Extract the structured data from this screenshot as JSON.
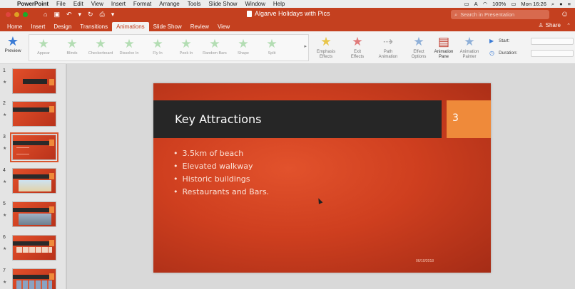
{
  "menubar": {
    "app_name": "PowerPoint",
    "items": [
      "File",
      "Edit",
      "View",
      "Insert",
      "Format",
      "Arrange",
      "Tools",
      "Slide Show",
      "Window",
      "Help"
    ],
    "battery": "100%",
    "clock": "Mon 16:26"
  },
  "titlebar": {
    "title": "Algarve Holidays with Pics",
    "search_placeholder": "Search in Presentation",
    "colors": {
      "accent": "#c4401f",
      "search_bg": "#d86a4e"
    }
  },
  "tabs": {
    "items": [
      "Home",
      "Insert",
      "Design",
      "Transitions",
      "Animations",
      "Slide Show",
      "Review",
      "View"
    ],
    "active": "Animations",
    "share_label": "Share"
  },
  "ribbon": {
    "preview_label": "Preview",
    "gallery": [
      "Appear",
      "Blinds",
      "Checkerboard",
      "Dissolve In",
      "Fly In",
      "Peek In",
      "Random Bars",
      "Shape",
      "Split"
    ],
    "buttons": [
      {
        "label1": "Emphasis",
        "label2": "Effects"
      },
      {
        "label1": "Exit",
        "label2": "Effects"
      },
      {
        "label1": "Path",
        "label2": "Animation"
      },
      {
        "label1": "Effect",
        "label2": "Options"
      },
      {
        "label1": "Animation",
        "label2": "Pane"
      },
      {
        "label1": "Animation",
        "label2": "Painter"
      }
    ],
    "start_label": "Start:",
    "duration_label": "Duration:"
  },
  "thumbnails": [
    {
      "num": "1",
      "title": "Welcome to Portugal"
    },
    {
      "num": "2",
      "title": ""
    },
    {
      "num": "3",
      "title": ""
    },
    {
      "num": "4",
      "title": ""
    },
    {
      "num": "5",
      "title": ""
    },
    {
      "num": "6",
      "title": ""
    },
    {
      "num": "7",
      "title": ""
    }
  ],
  "selected_slide": "3",
  "slide": {
    "title": "Key Attractions",
    "number": "3",
    "bullets": [
      "3.5km of beach",
      "Elevated walkway",
      "Historic buildings",
      "Restaurants and Bars."
    ],
    "date": "06/10/2018",
    "colors": {
      "background": "#cf3f1f",
      "title_bar": "#262626",
      "number_box": "#ef8a3a"
    }
  }
}
